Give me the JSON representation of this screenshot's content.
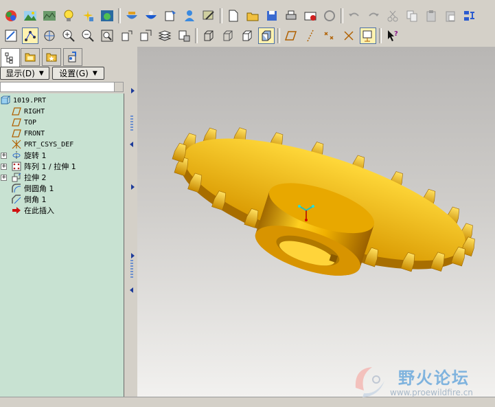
{
  "toolbar_top": {
    "icons": [
      "color-sphere-icon",
      "landscape-icon",
      "terrain-icon",
      "bulb-icon",
      "spark-icon",
      "sphere-scene-icon",
      "bowl-icon",
      "bowl-blue-icon",
      "box-arrow-icon",
      "person-icon",
      "tools-icon",
      "new-file-icon",
      "open-folder-icon",
      "save-icon",
      "print-icon",
      "send-icon",
      "refresh-icon",
      "undo-icon",
      "redo-icon",
      "cut-icon",
      "copy-icon",
      "paste-icon",
      "paste-special-icon",
      "regenerate-icon"
    ]
  },
  "toolbar_view": {
    "icons": [
      "repaint-icon",
      "datum-display-icon",
      "spin-center-icon",
      "zoom-in-icon",
      "zoom-out-icon",
      "refit-icon",
      "orient-icon",
      "saved-views-icon",
      "layers-icon",
      "appearance-icon",
      "wireframe-icon",
      "hidden-line-icon",
      "no-hidden-icon",
      "shading-icon",
      "datum-planes-icon",
      "datum-axes-icon",
      "datum-points-icon",
      "csys-icon",
      "annotations-icon",
      "help-cursor-icon"
    ]
  },
  "panel_tabs": [
    "model-tree-tab",
    "folder-browser-tab",
    "favorites-tab",
    "connections-tab"
  ],
  "panel_buttons": {
    "display_label": "显示(D)",
    "settings_label": "设置(G)"
  },
  "model_tree": {
    "root": "1019.PRT",
    "items": [
      {
        "label": "RIGHT",
        "icon": "datum-plane-icon",
        "expandable": false
      },
      {
        "label": "TOP",
        "icon": "datum-plane-icon",
        "expandable": false
      },
      {
        "label": "FRONT",
        "icon": "datum-plane-icon",
        "expandable": false
      },
      {
        "label": "PRT_CSYS_DEF",
        "icon": "csys-icon",
        "expandable": false
      },
      {
        "label": "旋转 1",
        "icon": "revolve-icon",
        "expandable": true
      },
      {
        "label": "阵列 1 / 拉伸 1",
        "icon": "pattern-icon",
        "expandable": true
      },
      {
        "label": "拉伸 2",
        "icon": "extrude-icon",
        "expandable": true
      },
      {
        "label": "倒圆角 1",
        "icon": "round-icon",
        "expandable": false
      },
      {
        "label": "倒角 1",
        "icon": "chamfer-icon",
        "expandable": false
      },
      {
        "label": "在此插入",
        "icon": "insert-here-icon",
        "expandable": false
      }
    ]
  },
  "watermark": {
    "title": "野火论坛",
    "url": "www.proewildfire.cn"
  },
  "colors": {
    "tree_bg": "#c8e2d2",
    "gear_gold": "#e8a800",
    "gear_dark": "#8a5a00",
    "gear_light": "#ffd83a"
  }
}
